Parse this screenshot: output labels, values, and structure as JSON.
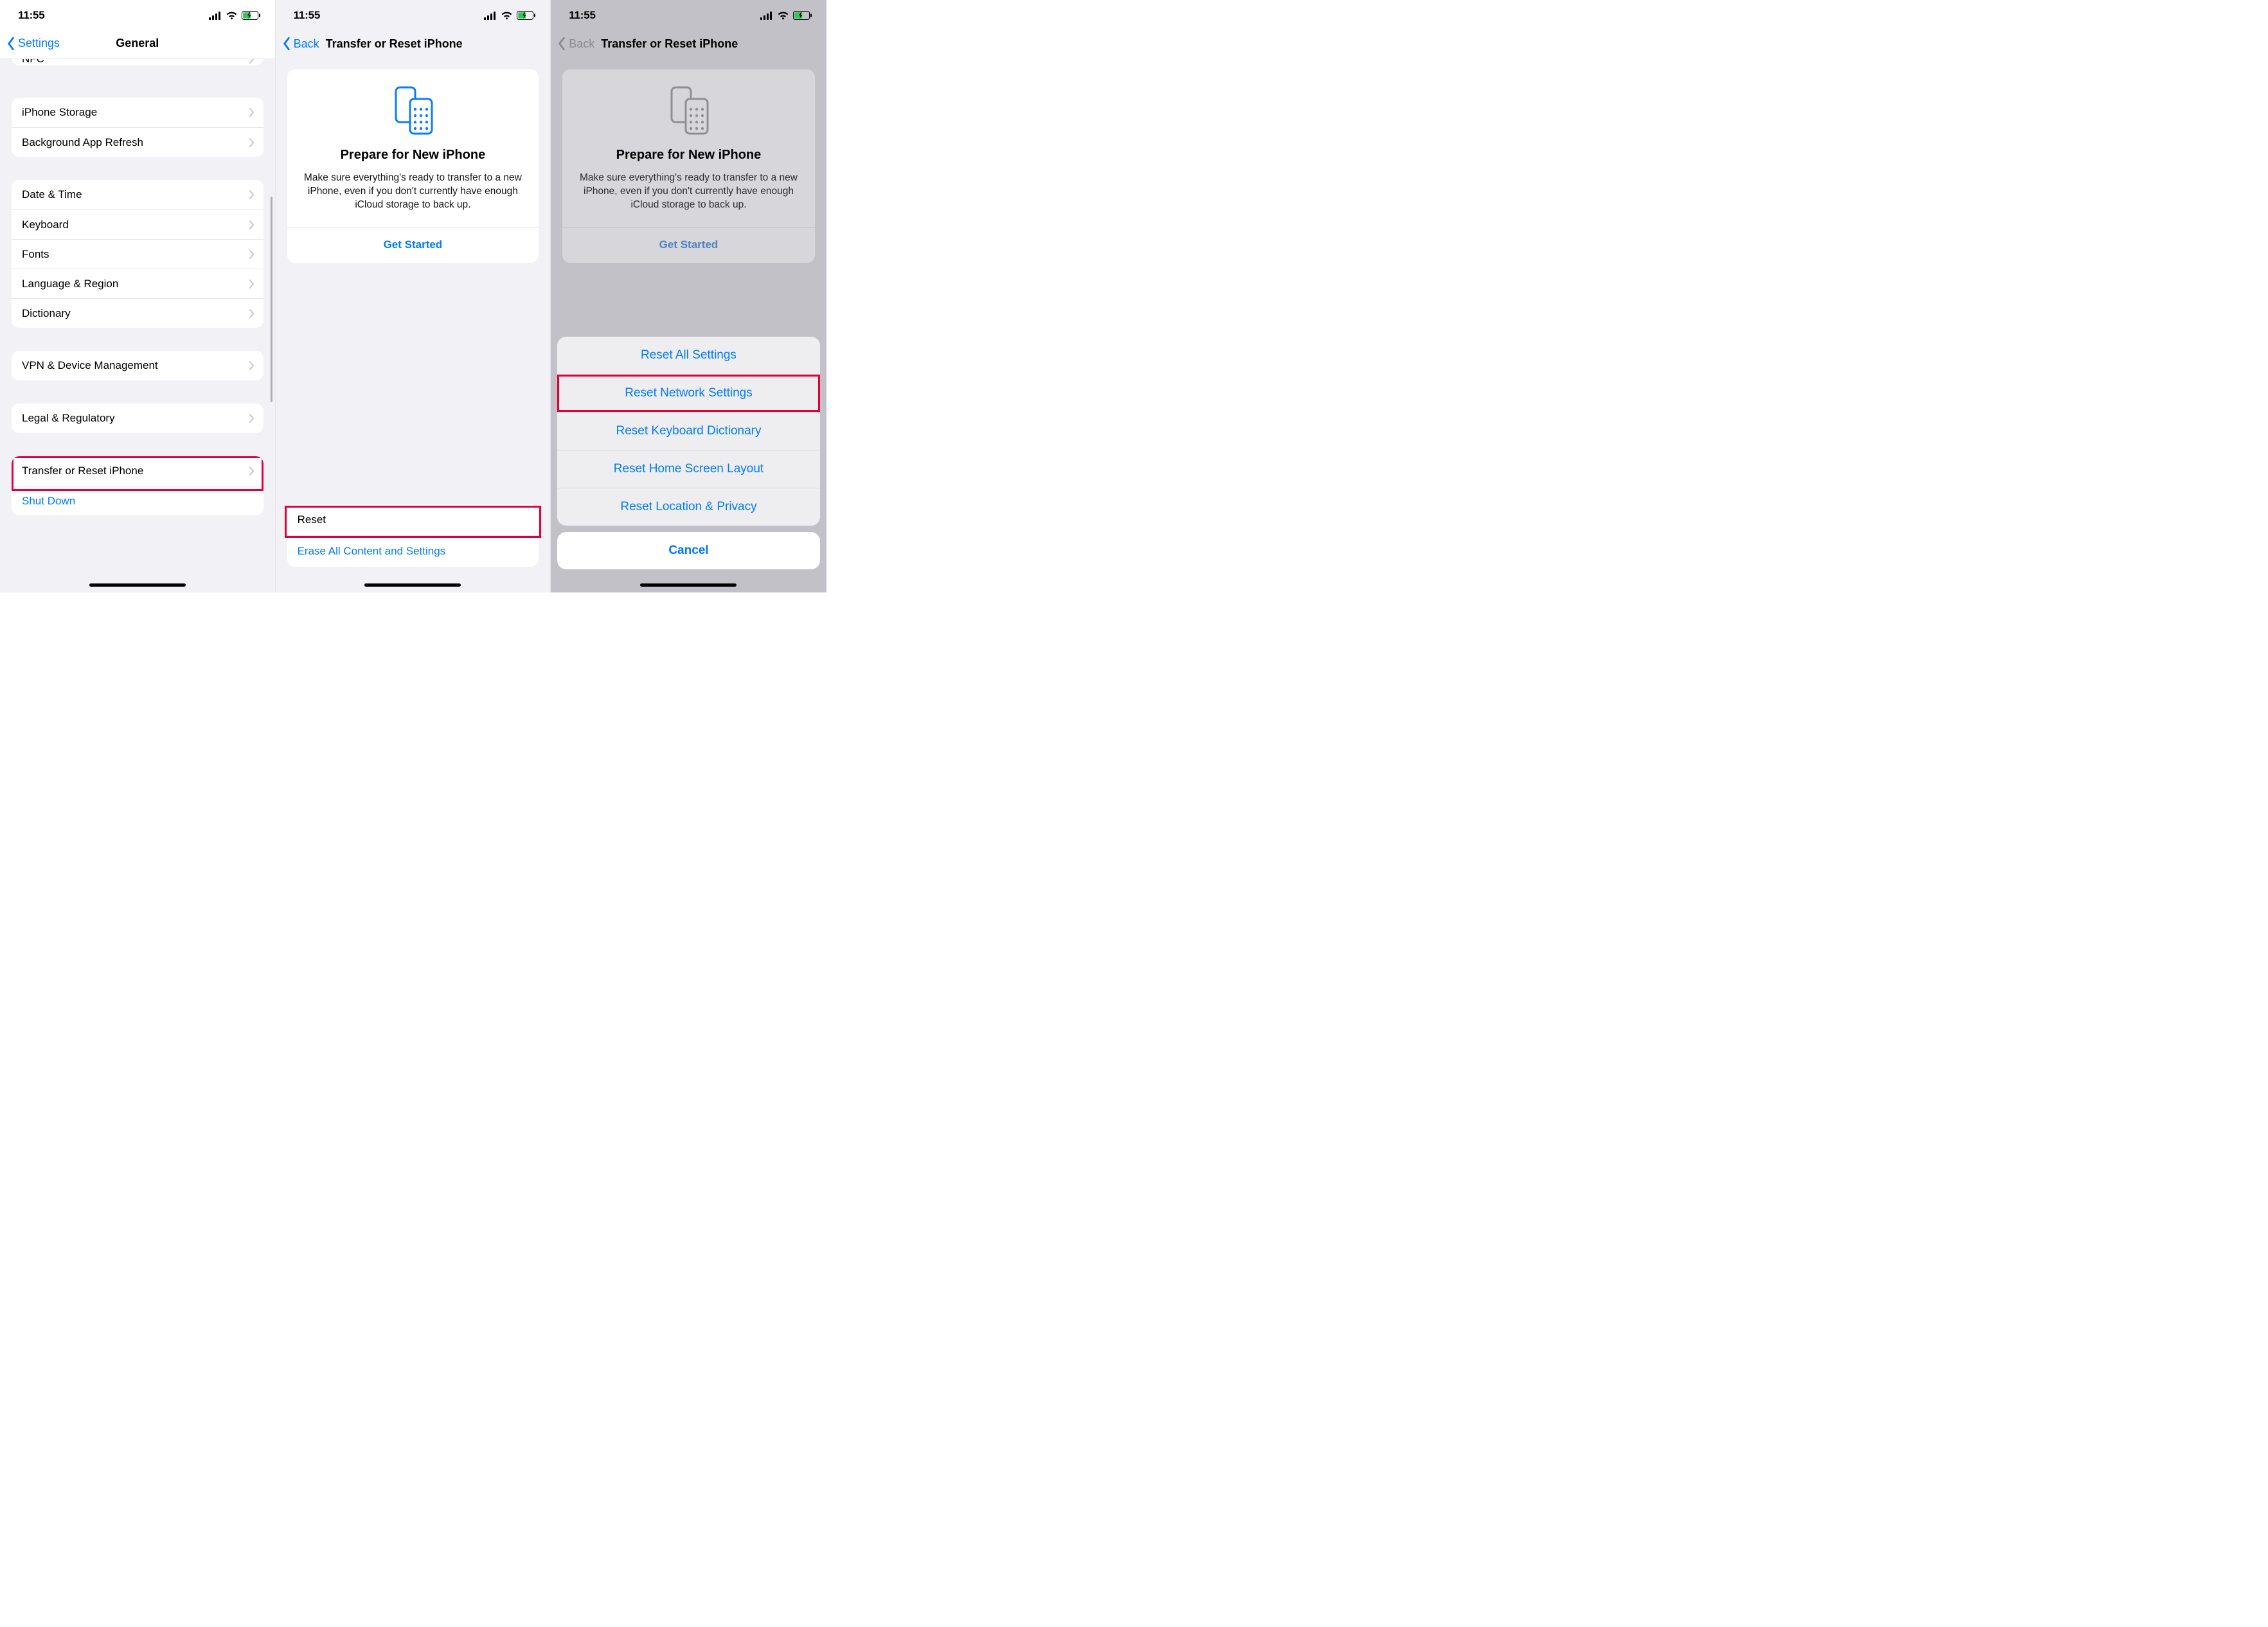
{
  "status": {
    "time": "11:55"
  },
  "screen1": {
    "back": "Settings",
    "title": "General",
    "partialRow": "NFC",
    "groups": [
      {
        "rows": [
          "iPhone Storage",
          "Background App Refresh"
        ]
      },
      {
        "rows": [
          "Date & Time",
          "Keyboard",
          "Fonts",
          "Language & Region",
          "Dictionary"
        ]
      },
      {
        "rows": [
          "VPN & Device Management"
        ]
      },
      {
        "rows": [
          "Legal & Regulatory"
        ]
      }
    ],
    "finalGroup": {
      "rows": [
        "Transfer or Reset iPhone",
        "Shut Down"
      ],
      "highlightIndex": 0,
      "blueIndex": 1
    }
  },
  "screen2": {
    "back": "Back",
    "title": "Transfer or Reset iPhone",
    "card": {
      "heading": "Prepare for New iPhone",
      "desc": "Make sure everything's ready to transfer to a new iPhone, even if you don't currently have enough iCloud storage to back up.",
      "cta": "Get Started"
    },
    "bottom": {
      "rows": [
        "Reset",
        "Erase All Content and Settings"
      ],
      "highlightIndex": 0
    }
  },
  "screen3": {
    "back": "Back",
    "title": "Transfer or Reset iPhone",
    "card": {
      "heading": "Prepare for New iPhone",
      "desc": "Make sure everything's ready to transfer to a new iPhone, even if you don't currently have enough iCloud storage to back up.",
      "cta": "Get Started"
    },
    "sheet": {
      "options": [
        "Reset All Settings",
        "Reset Network Settings",
        "Reset Keyboard Dictionary",
        "Reset Home Screen Layout",
        "Reset Location & Privacy"
      ],
      "highlightIndex": 1,
      "cancel": "Cancel"
    }
  }
}
